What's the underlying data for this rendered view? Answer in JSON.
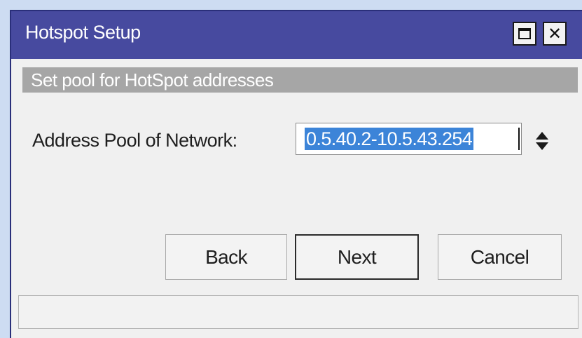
{
  "window": {
    "title": "Hotspot Setup",
    "maximize_icon": "maximize-icon",
    "close_icon": "close-icon"
  },
  "step": {
    "subtitle": "Set pool for HotSpot addresses"
  },
  "form": {
    "address_pool": {
      "label": "Address Pool of Network:",
      "value": "0.5.40.2-10.5.43.254",
      "stepper_icon": "up-down-arrows-icon"
    }
  },
  "buttons": {
    "back": "Back",
    "next": "Next",
    "cancel": "Cancel"
  },
  "status": {
    "text": ""
  },
  "colors": {
    "titlebar": "#474a9f",
    "subtitle_bar": "#a6a6a6",
    "selection": "#3c84d8",
    "dialog_background": "#f0f0f0"
  }
}
